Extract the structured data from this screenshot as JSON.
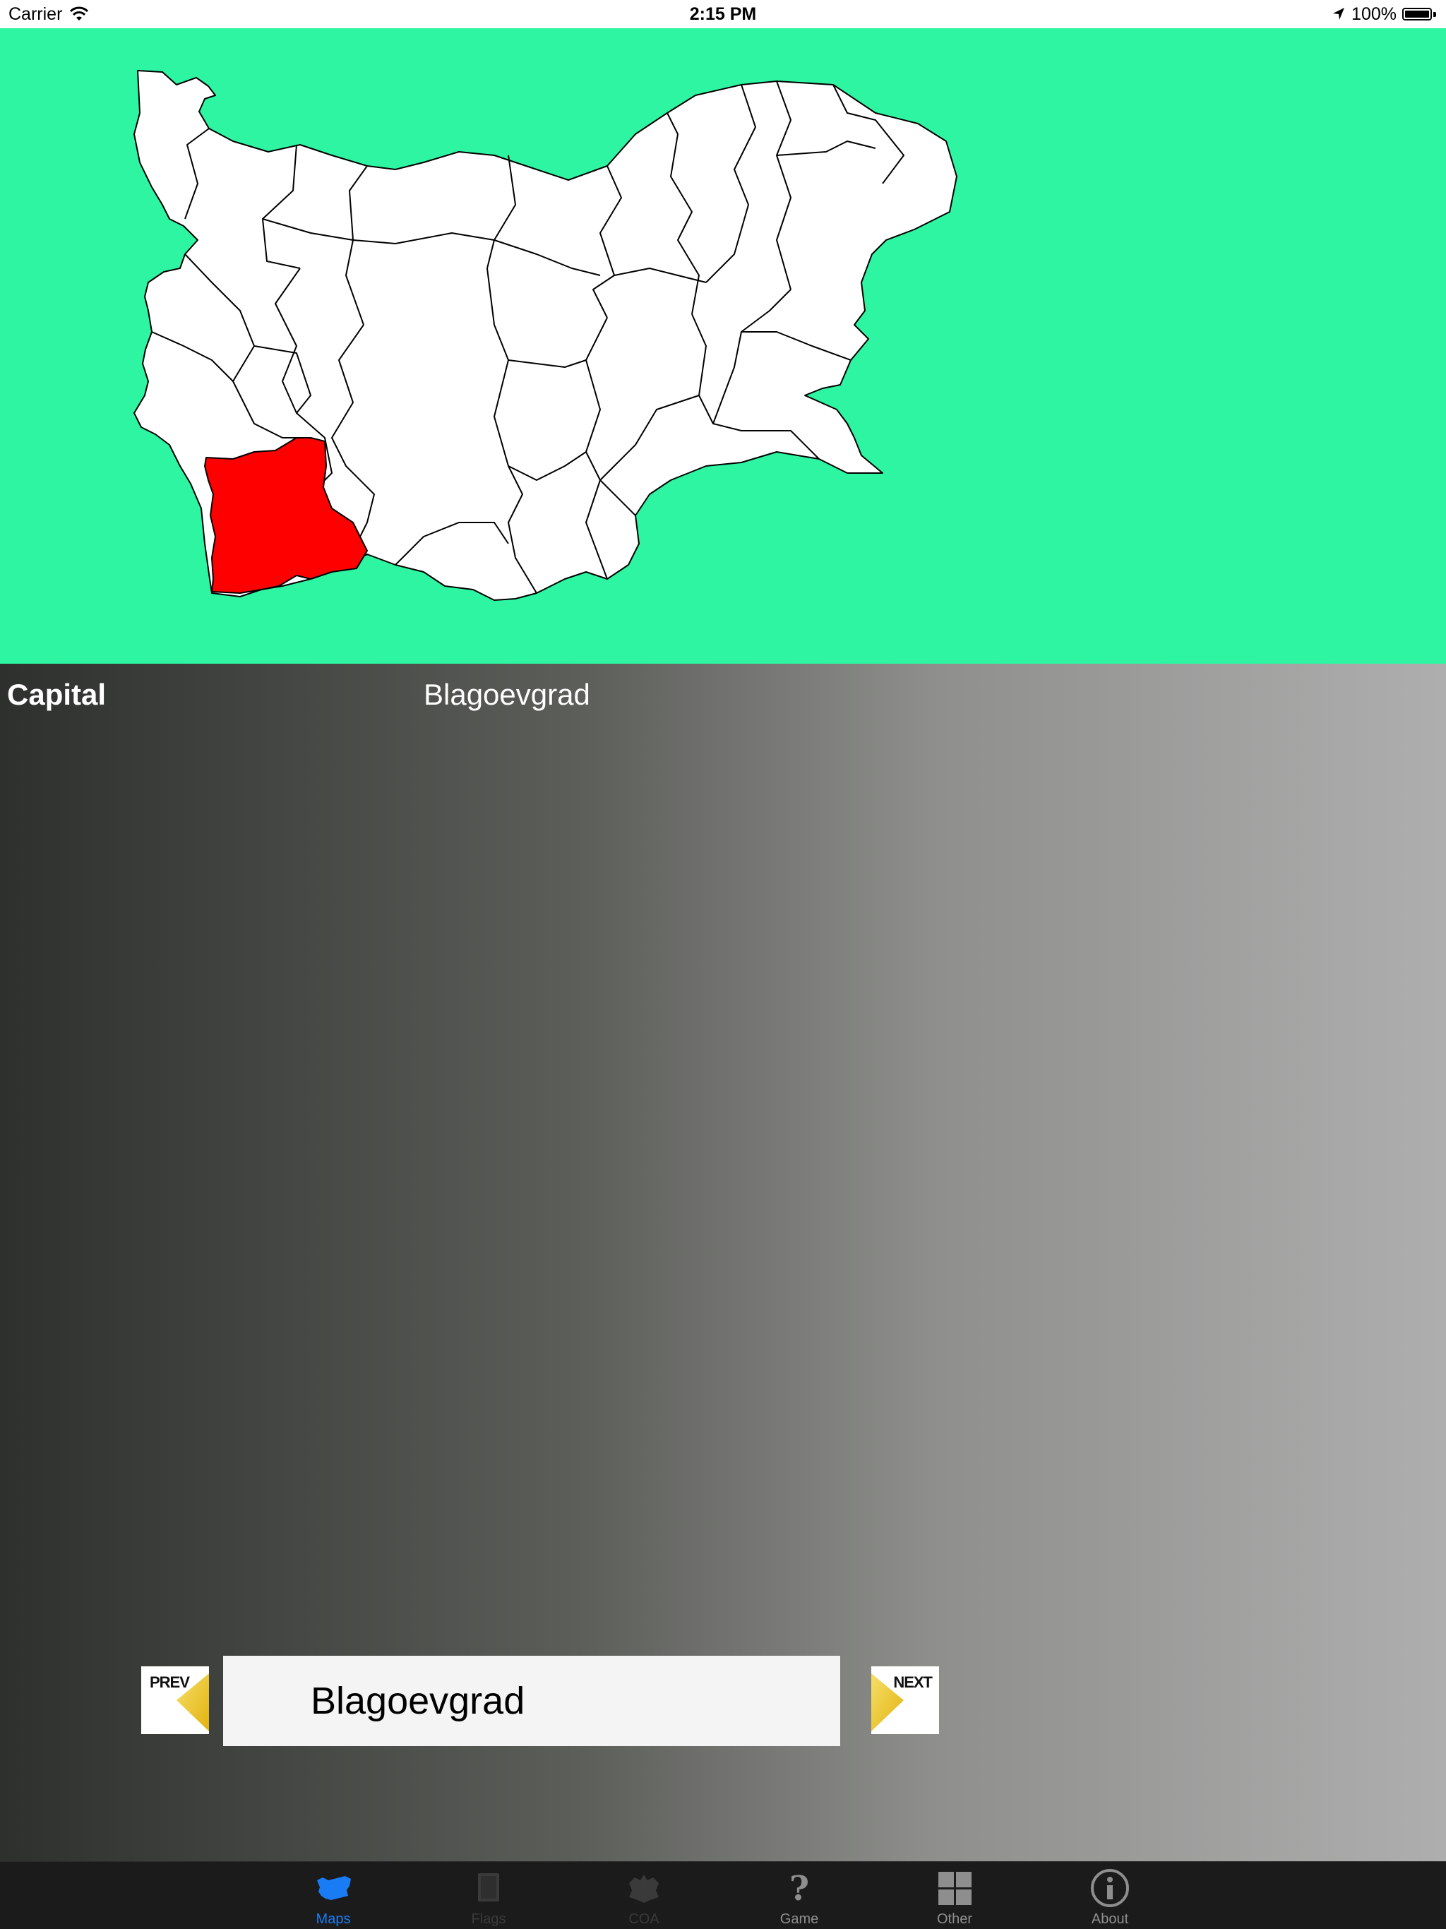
{
  "status": {
    "carrier": "Carrier",
    "time": "2:15 PM",
    "battery": "100%"
  },
  "colors": {
    "map_background": "#2ef5a2",
    "region_fill": "#ffffff",
    "selected_region_fill": "#ff0000",
    "tab_active": "#1a7cf5",
    "tab_inactive": "#8e8e8e"
  },
  "info": {
    "capital_label": "Capital",
    "capital_value": "Blagoevgrad"
  },
  "navigator": {
    "prev_label": "PREV",
    "next_label": "NEXT",
    "current_name": "Blagoevgrad"
  },
  "tabs": [
    {
      "label": "Maps",
      "icon": "bulgaria-map-icon",
      "state": "active"
    },
    {
      "label": "Flags",
      "icon": "flag-book-icon",
      "state": "disabled"
    },
    {
      "label": "COA",
      "icon": "coat-of-arms-icon",
      "state": "disabled"
    },
    {
      "label": "Game",
      "icon": "question-mark-icon",
      "state": "normal"
    },
    {
      "label": "Other",
      "icon": "grid-icon",
      "state": "normal"
    },
    {
      "label": "About",
      "icon": "info-icon",
      "state": "normal"
    }
  ]
}
